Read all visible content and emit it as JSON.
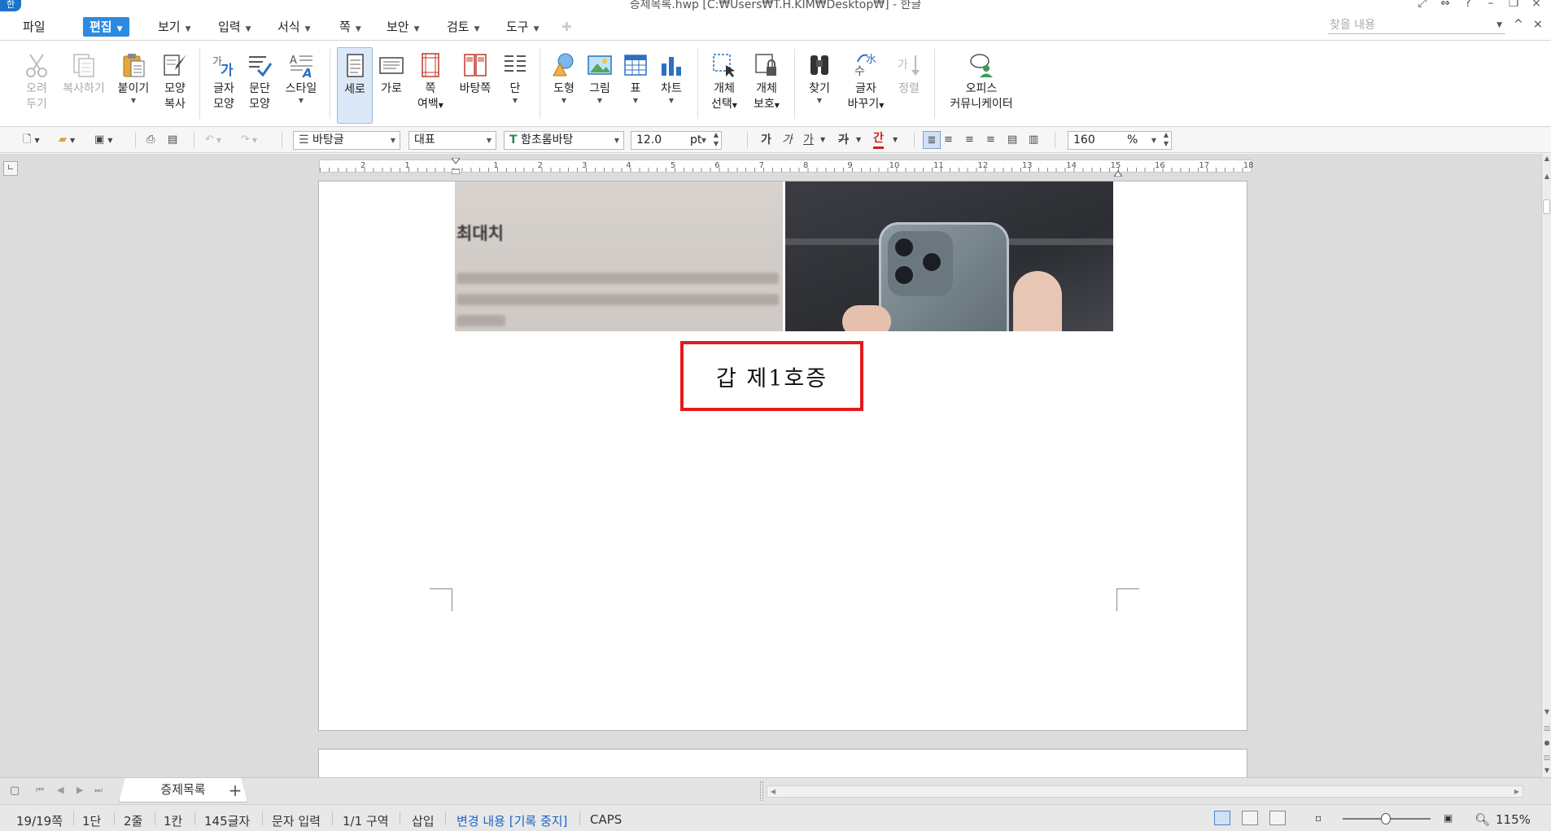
{
  "window": {
    "title": "증제목록.hwp [C:₩Users₩T.H.KIM₩Desktop₩] - 한글",
    "logo": "한",
    "controls": [
      "⤢",
      "⇔",
      "?",
      "–",
      "❐",
      "×"
    ]
  },
  "menubar": {
    "items": [
      {
        "label": "파일",
        "caret": false
      },
      {
        "label": "편집",
        "caret": true,
        "active": true
      },
      {
        "label": "보기",
        "caret": true
      },
      {
        "label": "입력",
        "caret": true
      },
      {
        "label": "서식",
        "caret": true
      },
      {
        "label": "쪽",
        "caret": true
      },
      {
        "label": "보안",
        "caret": true
      },
      {
        "label": "검토",
        "caret": true
      },
      {
        "label": "도구",
        "caret": true
      }
    ],
    "search_placeholder": "찾을 내용",
    "collapse_icon": "^"
  },
  "ribbon": {
    "buttons": [
      {
        "id": "cut",
        "lines": [
          "오려",
          "두기"
        ],
        "icon": "scissors-icon",
        "disabled": true
      },
      {
        "id": "copy",
        "lines": [
          "복사하기"
        ],
        "icon": "copy-icon",
        "disabled": true
      },
      {
        "id": "paste",
        "lines": [
          "붙이기"
        ],
        "icon": "clipboard-icon",
        "dropdown": true
      },
      {
        "id": "format-copy",
        "lines": [
          "모양",
          "복사"
        ],
        "icon": "format-painter-icon"
      },
      {
        "id": "char-shape",
        "lines": [
          "글자",
          "모양"
        ],
        "icon": "char-shape-icon"
      },
      {
        "id": "para-shape",
        "lines": [
          "문단",
          "모양"
        ],
        "icon": "paragraph-shape-icon"
      },
      {
        "id": "style",
        "lines": [
          "스타일"
        ],
        "icon": "style-icon",
        "dropdown": true
      },
      {
        "id": "portrait",
        "lines": [
          "세로"
        ],
        "icon": "portrait-page-icon",
        "selected": true
      },
      {
        "id": "landscape",
        "lines": [
          "가로"
        ],
        "icon": "landscape-page-icon"
      },
      {
        "id": "margin",
        "lines": [
          "쪽",
          "여백"
        ],
        "icon": "page-margin-icon",
        "dropdown_inline": true
      },
      {
        "id": "background",
        "lines": [
          "바탕쪽"
        ],
        "icon": "master-page-icon"
      },
      {
        "id": "columns",
        "lines": [
          "단"
        ],
        "icon": "columns-icon",
        "dropdown": true
      },
      {
        "id": "shape",
        "lines": [
          "도형"
        ],
        "icon": "shape-icon",
        "dropdown": true
      },
      {
        "id": "picture",
        "lines": [
          "그림"
        ],
        "icon": "picture-icon",
        "dropdown": true
      },
      {
        "id": "table",
        "lines": [
          "표"
        ],
        "icon": "table-icon",
        "dropdown": true
      },
      {
        "id": "chart",
        "lines": [
          "차트"
        ],
        "icon": "chart-icon",
        "dropdown": true
      },
      {
        "id": "select-object",
        "lines": [
          "개체",
          "선택"
        ],
        "icon": "select-object-icon",
        "dropdown_inline": true
      },
      {
        "id": "protect-object",
        "lines": [
          "개체",
          "보호"
        ],
        "icon": "protect-object-icon",
        "dropdown_inline": true
      },
      {
        "id": "find",
        "lines": [
          "찾기"
        ],
        "icon": "binoculars-icon",
        "dropdown": true
      },
      {
        "id": "replace",
        "lines": [
          "글자",
          "바꾸기"
        ],
        "icon": "replace-icon",
        "dropdown_inline": true
      },
      {
        "id": "sort",
        "lines": [
          "정렬"
        ],
        "icon": "sort-icon",
        "disabled": true
      },
      {
        "id": "office-communicator",
        "lines": [
          "오피스",
          "커뮤니케이터"
        ],
        "icon": "communicator-icon"
      }
    ]
  },
  "format_toolbar": {
    "style_value": "바탕글",
    "font_lang_value": "대표",
    "font_value": "함초롬바탕",
    "font_size_value": "12.0",
    "font_size_unit": "pt",
    "bold_glyph": "가",
    "italic_glyph": "가",
    "underline_glyph": "가",
    "strike_glyph": "가",
    "color_glyph": "간",
    "line_spacing_value": "160",
    "line_spacing_unit": "%"
  },
  "ruler": {
    "numbers": [
      "2",
      "1",
      "1",
      "2",
      "3",
      "4",
      "5",
      "6",
      "7",
      "8",
      "9",
      "10",
      "11",
      "12",
      "13",
      "14",
      "15",
      "16",
      "17",
      "18"
    ]
  },
  "document": {
    "photo_left_text": "최대치",
    "exhibit_label": "갑  제1호증"
  },
  "sheet_tabs": {
    "tabs": [
      "증제목록"
    ],
    "add_label": "+"
  },
  "statusbar": {
    "page": "19/19쪽",
    "column": "1단",
    "line": "2줄",
    "cell": "1칸",
    "chars": "145글자",
    "mode": "문자 입력",
    "section": "1/1 구역",
    "insert": "삽입",
    "track_changes": "변경 내용 [기록 중지]",
    "caps": "CAPS",
    "zoom": "115%"
  },
  "colors": {
    "accent": "#2b8be0",
    "exhibit_border": "#e41a1c",
    "track_changes_text": "#1e63c5"
  }
}
